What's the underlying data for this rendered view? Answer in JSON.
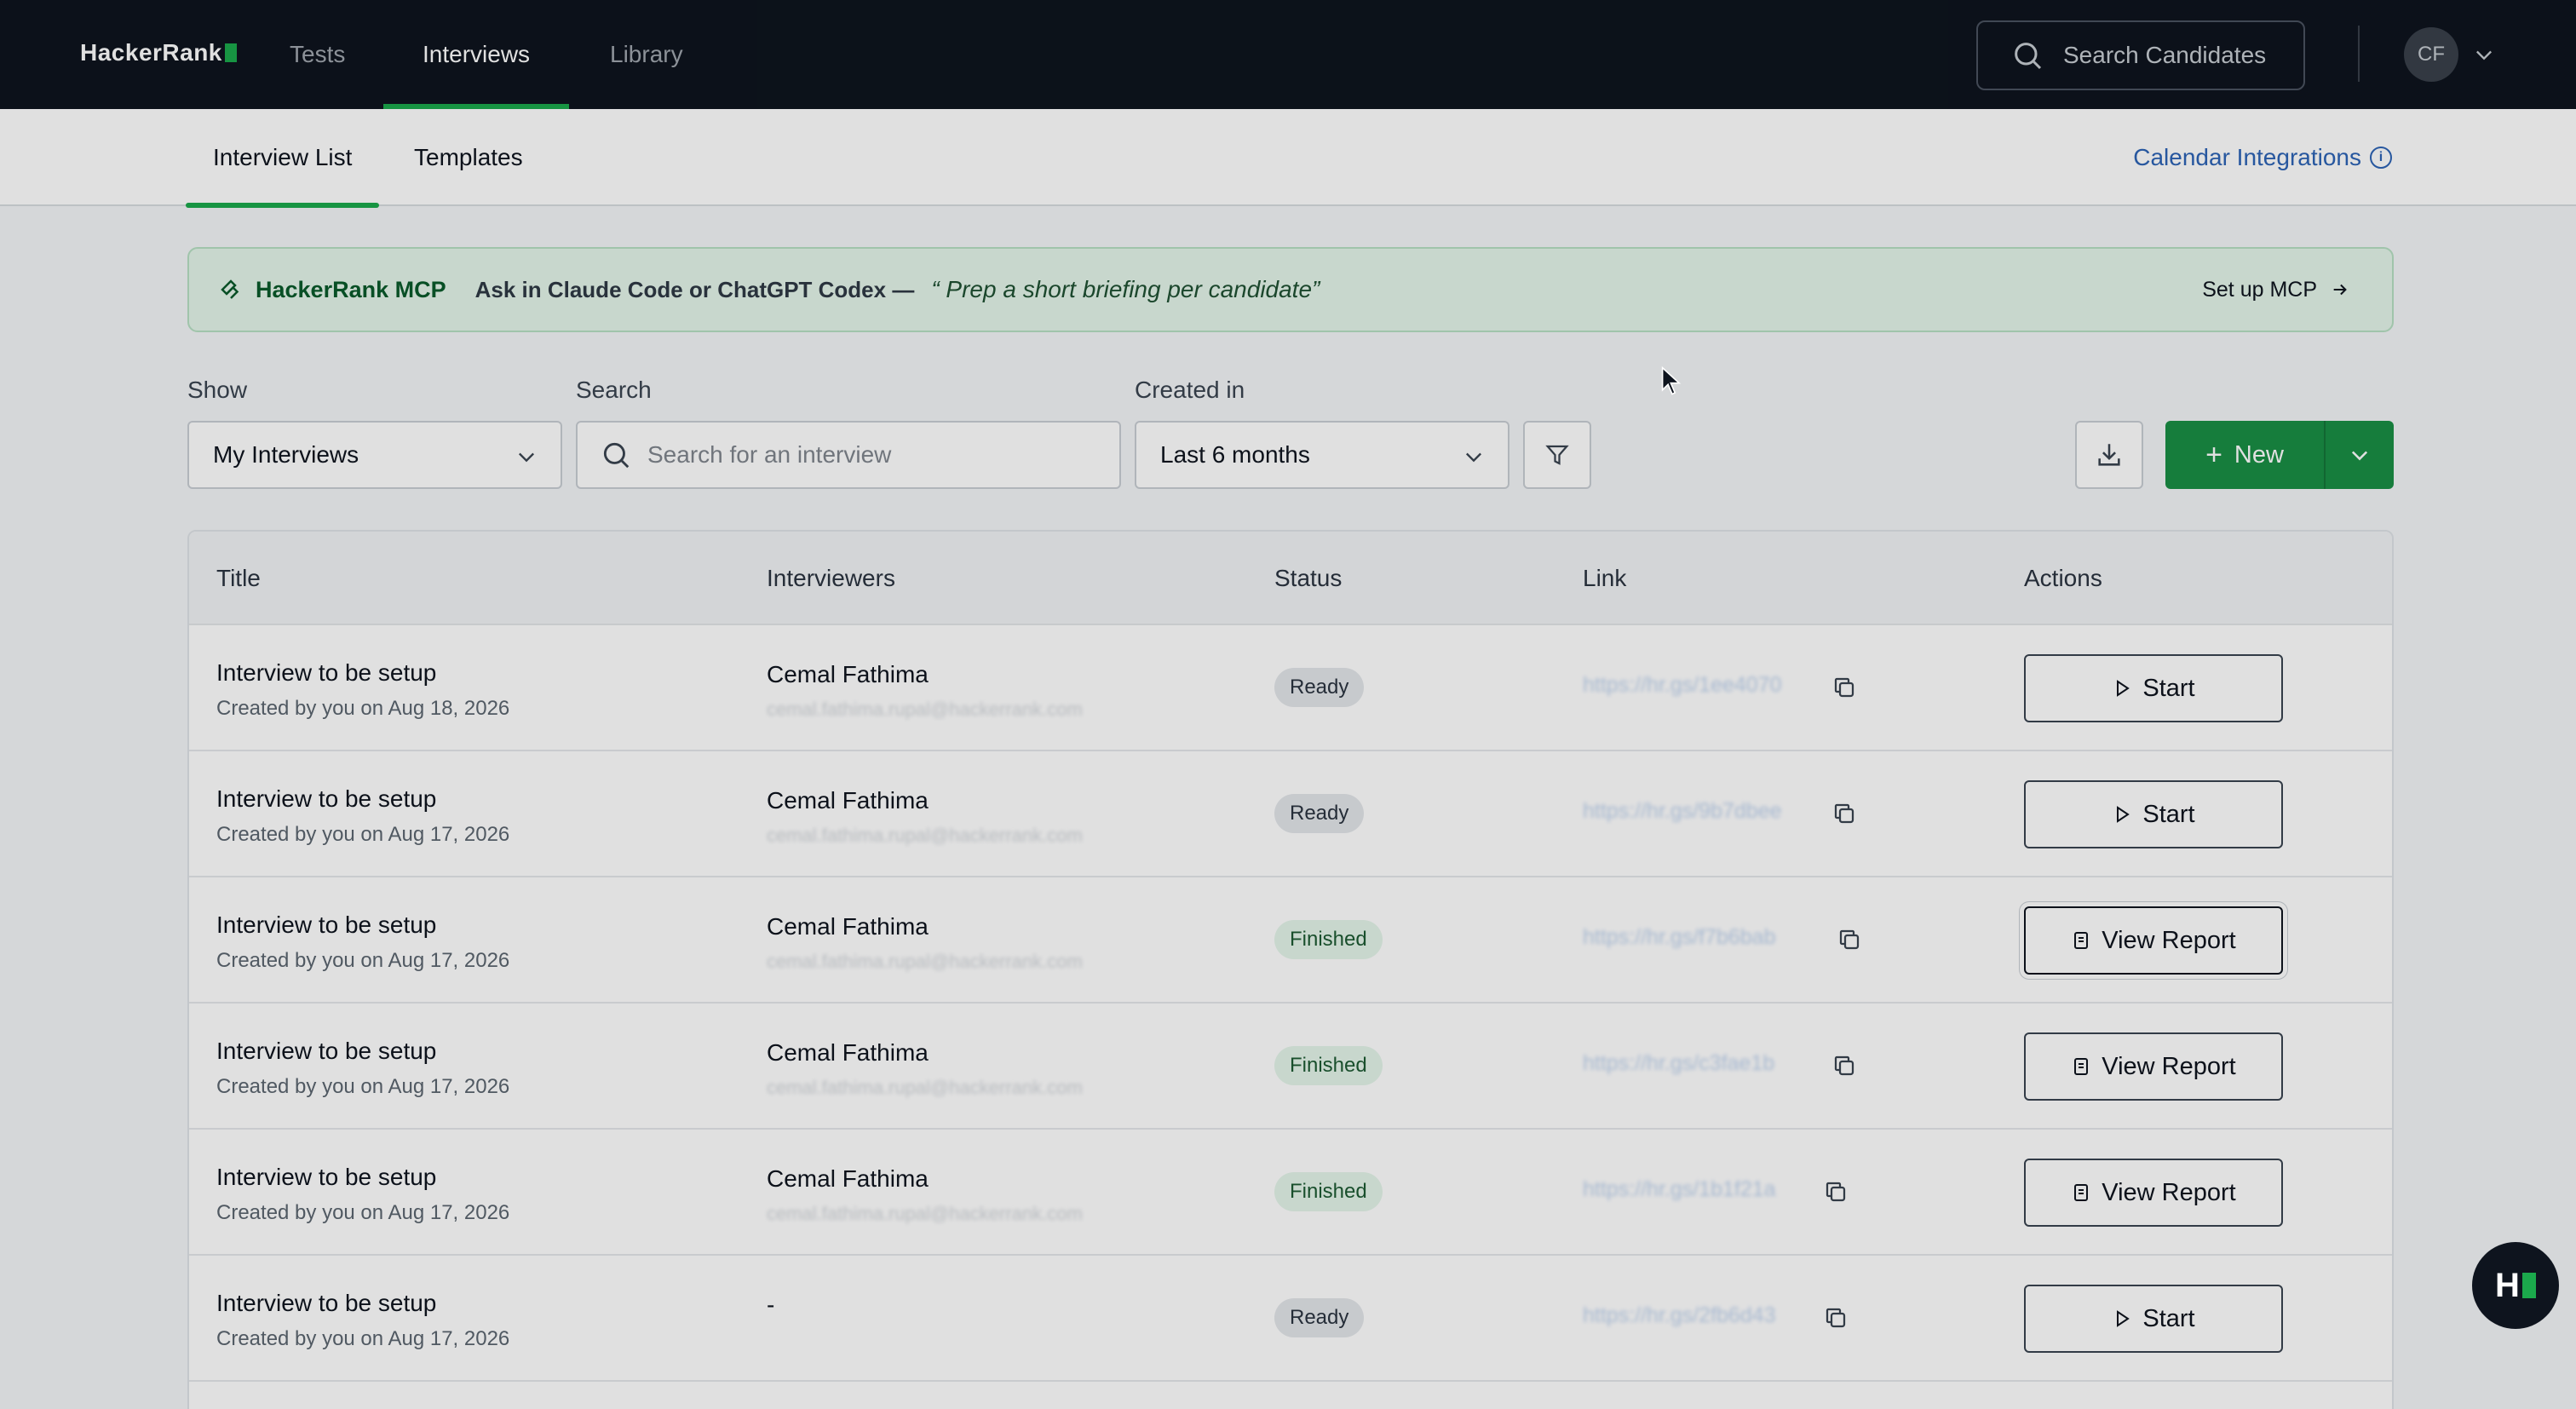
{
  "nav": {
    "logo": "HackerRank",
    "links": [
      "Tests",
      "Interviews",
      "Library"
    ],
    "active": "Interviews",
    "search_placeholder": "Search Candidates",
    "avatar_initials": "CF"
  },
  "subnav": {
    "tabs": [
      "Interview List",
      "Templates"
    ],
    "active": "Interview List",
    "calendar_link": "Calendar Integrations",
    "info_glyph": "i"
  },
  "banner": {
    "title": "HackerRank MCP",
    "text": "Ask in Claude Code or ChatGPT Codex —",
    "quote": "“ Prep a short briefing per candidate”",
    "setup_label": "Set up MCP"
  },
  "filters": {
    "show_label": "Show",
    "show_value": "My Interviews",
    "search_label": "Search",
    "search_placeholder": "Search for an interview",
    "created_label": "Created in",
    "created_value": "Last 6 months",
    "new_label": "New",
    "new_plus": "+"
  },
  "table": {
    "columns": [
      "Title",
      "Interviewers",
      "Status",
      "Link",
      "Actions"
    ],
    "rows": [
      {
        "title": "Interview to be setup",
        "created": "Created by you on Aug 18, 2026",
        "interviewer": "Cemal Fathima",
        "email": "cemal.fathima.rupal@hackerrank.com",
        "status": "Ready",
        "link": "https://hr.gs/1ee4070",
        "action": "Start"
      },
      {
        "title": "Interview to be setup",
        "created": "Created by you on Aug 17, 2026",
        "interviewer": "Cemal Fathima",
        "email": "cemal.fathima.rupal@hackerrank.com",
        "status": "Ready",
        "link": "https://hr.gs/9b7dbee",
        "action": "Start"
      },
      {
        "title": "Interview to be setup",
        "created": "Created by you on Aug 17, 2026",
        "interviewer": "Cemal Fathima",
        "email": "cemal.fathima.rupal@hackerrank.com",
        "status": "Finished",
        "link": "https://hr.gs/f7b6bab",
        "action": "View Report"
      },
      {
        "title": "Interview to be setup",
        "created": "Created by you on Aug 17, 2026",
        "interviewer": "Cemal Fathima",
        "email": "cemal.fathima.rupal@hackerrank.com",
        "status": "Finished",
        "link": "https://hr.gs/c3fae1b",
        "action": "View Report"
      },
      {
        "title": "Interview to be setup",
        "created": "Created by you on Aug 17, 2026",
        "interviewer": "Cemal Fathima",
        "email": "cemal.fathima.rupal@hackerrank.com",
        "status": "Finished",
        "link": "https://hr.gs/1b1f21a",
        "action": "View Report"
      },
      {
        "title": "Interview to be setup",
        "created": "Created by you on Aug 17, 2026",
        "interviewer": "-",
        "email": "",
        "status": "Ready",
        "link": "https://hr.gs/2fb6d43",
        "action": "Start"
      }
    ]
  },
  "fab_label": "H",
  "colors": {
    "brand_green": "#1ba94c",
    "nav_bg": "#0e141e",
    "link_blue": "#2d64b5"
  },
  "icons": [
    "search-icon",
    "chevron-down-icon",
    "mcp-icon",
    "arrow-right-icon",
    "filter-icon",
    "download-icon",
    "copy-icon",
    "play-icon",
    "report-icon",
    "info-icon"
  ]
}
